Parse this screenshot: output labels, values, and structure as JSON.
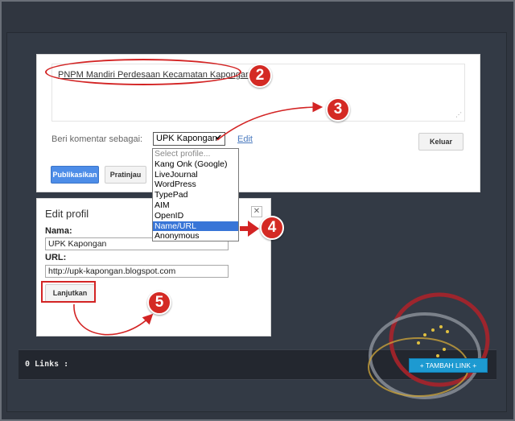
{
  "comment": {
    "text": "PNPM Mandiri Perdesaan Kecamatan Kapongan",
    "comment_as_label": "Beri komentar sebagai:",
    "selected_profile": "UPK Kapongan",
    "edit_link": "Edit",
    "logout_button": "Keluar",
    "publish_button": "Publikasikan",
    "preview_button": "Pratinjau"
  },
  "profile_dropdown": {
    "options": [
      "Select profile...",
      "Kang Onk (Google)",
      "LiveJournal",
      "WordPress",
      "TypePad",
      "AIM",
      "OpenID",
      "Name/URL",
      "Anonymous"
    ],
    "highlighted": "Name/URL"
  },
  "edit_profile": {
    "title": "Edit profil",
    "close_icon": "close-icon",
    "name_label": "Nama:",
    "name_value": "UPK Kapongan",
    "url_label": "URL:",
    "url_value": "http://upk-kapongan.blogspot.com",
    "continue_button": "Lanjutkan"
  },
  "annotations": {
    "step2": "2",
    "step3": "3",
    "step4": "4",
    "step5": "5",
    "color": "#d32424"
  },
  "links_bar": {
    "label": "0 Links :",
    "add_link_button": "+ TAMBAH LINK +"
  },
  "colors": {
    "background": "#2f3540",
    "primary_button": "#4d8de8",
    "add_link_button": "#1d9ad1",
    "annotation_red": "#d42a24",
    "dropdown_highlight": "#3875d7"
  }
}
